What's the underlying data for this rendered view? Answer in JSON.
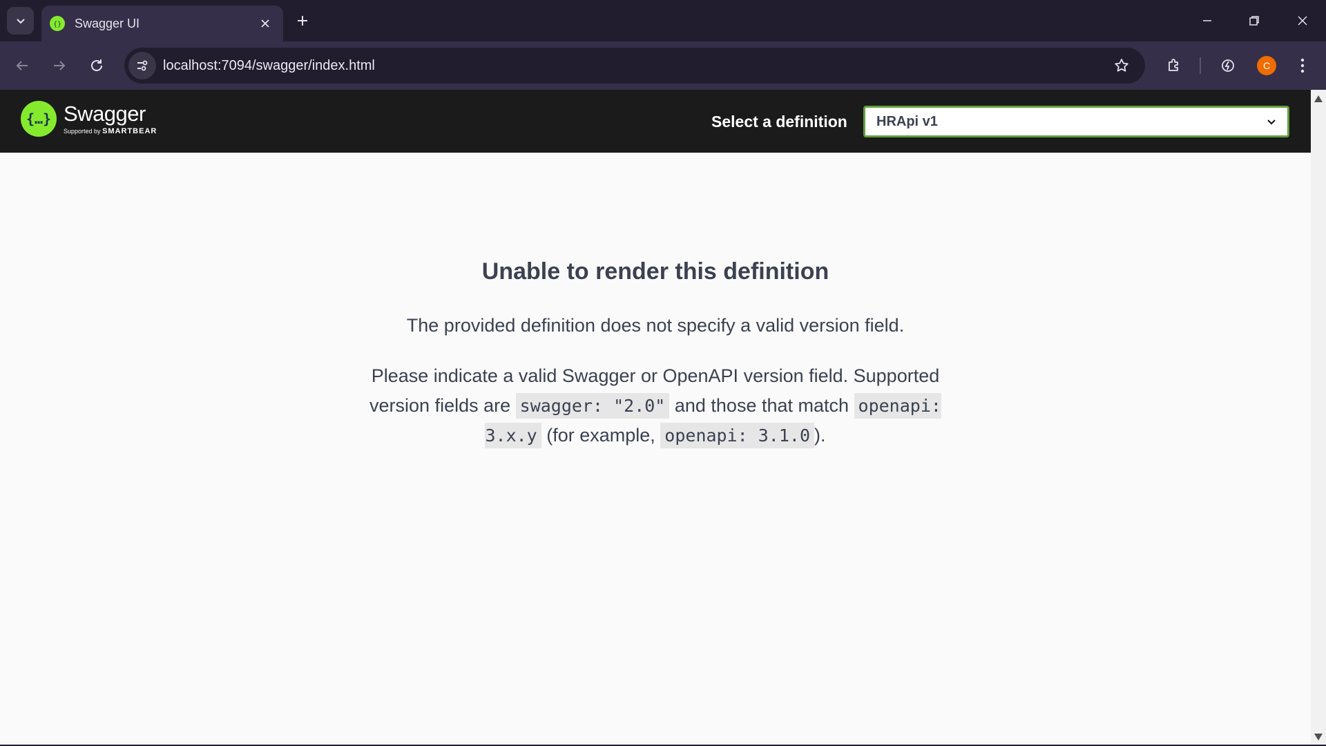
{
  "browser": {
    "tab_title": "Swagger UI",
    "url_host": "localhost",
    "url_rest": ":7094/swagger/index.html",
    "profile_initial": "C"
  },
  "swagger": {
    "brand": "Swagger",
    "supported_by": "Supported by",
    "smartbear": "SMARTBEAR",
    "select_label": "Select a definition",
    "selected_definition": "HRApi v1"
  },
  "error": {
    "title": "Unable to render this definition",
    "message": "The provided definition does not specify a valid version field.",
    "help_part1": "Please indicate a valid Swagger or OpenAPI version field. Supported version fields are ",
    "code_swagger": "swagger: \"2.0\"",
    "help_part2": " and those that match ",
    "code_openapi_pattern": "openapi: 3.x.y",
    "help_part3": " (for example, ",
    "code_openapi_example": "openapi: 3.1.0",
    "help_part4": ")."
  },
  "colors": {
    "swagger_green": "#85ea2d",
    "select_border": "#62a03f",
    "topbar_bg": "#1b1b1b",
    "chrome_dark": "#211d2e",
    "chrome_toolbar": "#352f49",
    "text": "#3b4151"
  },
  "icons": [
    "tab-search-icon",
    "swagger-favicon",
    "close-icon",
    "plus-icon",
    "minimize-icon",
    "restore-icon",
    "window-close-icon",
    "back-arrow-icon",
    "forward-arrow-icon",
    "reload-icon",
    "site-info-icon",
    "bookmark-star-icon",
    "extensions-icon",
    "performance-icon",
    "more-vert-icon",
    "chevron-down-icon",
    "swagger-logo-icon"
  ]
}
